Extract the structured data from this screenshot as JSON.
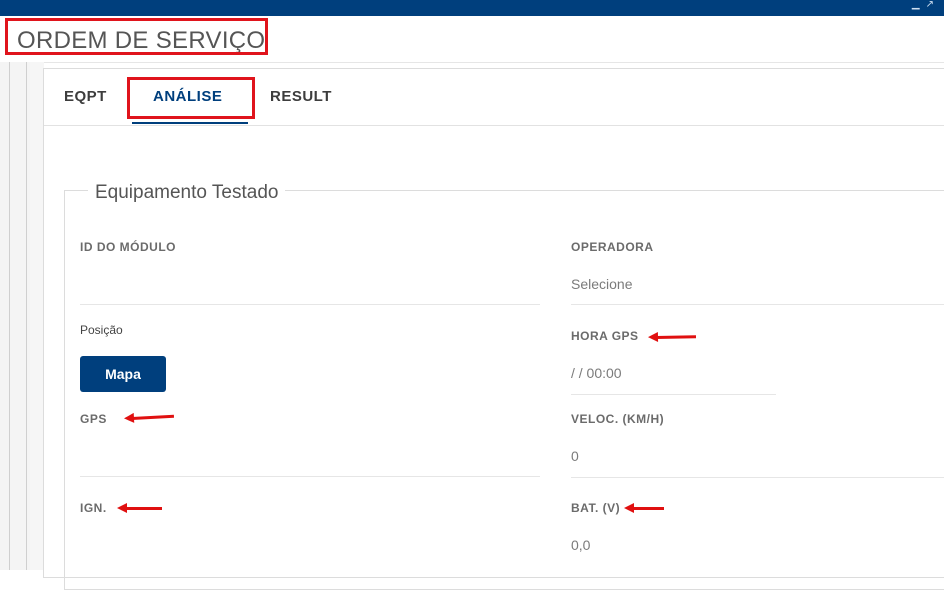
{
  "header": {
    "title": "ORDEM DE SERVIÇO"
  },
  "tabs": [
    {
      "label": "EQPT",
      "active": false
    },
    {
      "label": "ANÁLISE",
      "active": true
    },
    {
      "label": "RESULT",
      "active": false
    }
  ],
  "section": {
    "legend": "Equipamento Testado",
    "fields": {
      "id_modulo": {
        "label": "ID DO MÓDULO",
        "value": ""
      },
      "operadora": {
        "label": "OPERADORA",
        "value": "Selecione"
      },
      "posicao": {
        "label": "Posição",
        "button": "Mapa"
      },
      "hora_gps": {
        "label": "HORA GPS",
        "value": "/ / 00:00"
      },
      "gps": {
        "label": "GPS",
        "value": ""
      },
      "veloc": {
        "label": "VELOC. (KM/H)",
        "value": "0"
      },
      "ign": {
        "label": "IGN.",
        "value": ""
      },
      "bat": {
        "label": "BAT. (V)",
        "value": "0,0"
      }
    }
  },
  "colors": {
    "brand": "#003f7d",
    "highlight": "#e0141c"
  },
  "icons": [
    "minimize-icon",
    "expand-icon"
  ]
}
